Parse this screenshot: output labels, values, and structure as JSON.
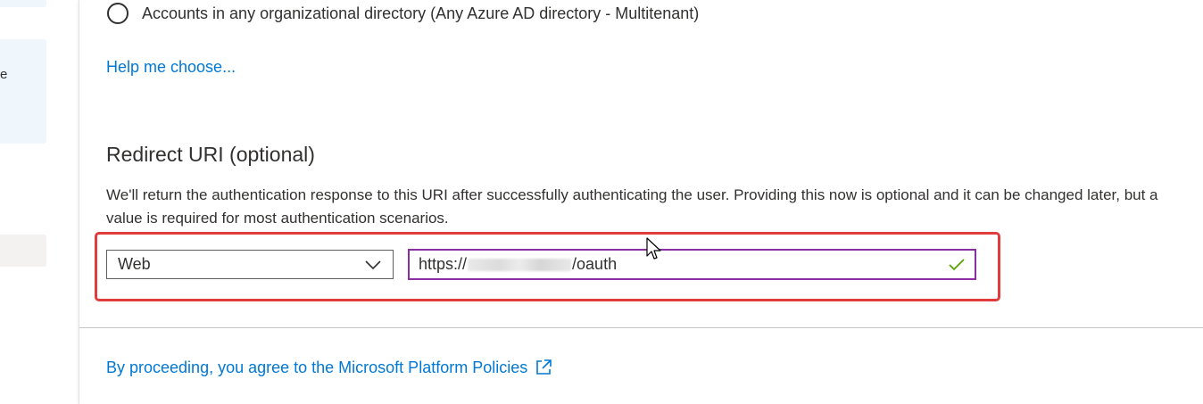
{
  "left_rail": {
    "partial_text": "e"
  },
  "account_types": {
    "multitenant_label": "Accounts in any organizational directory (Any Azure AD directory - Multitenant)"
  },
  "help_link": "Help me choose...",
  "redirect_uri": {
    "title": "Redirect URI (optional)",
    "description": "We'll return the authentication response to this URI after successfully authenticating the user. Providing this now is optional and it can be changed later, but a value is required for most authentication scenarios.",
    "platform_value": "Web",
    "uri_prefix": "https://",
    "uri_suffix": "/oauth"
  },
  "footer": {
    "policies_link": "By proceeding, you agree to the Microsoft Platform Policies"
  },
  "icons": {
    "chevron": "chevron-down-icon",
    "check": "checkmark-icon",
    "external": "external-link-icon",
    "cursor": "mouse-pointer-icon"
  },
  "colors": {
    "link": "#0078d4",
    "focus_border": "#8b2fa3",
    "valid_check": "#57a300",
    "annotation_red": "#e03c3c"
  }
}
